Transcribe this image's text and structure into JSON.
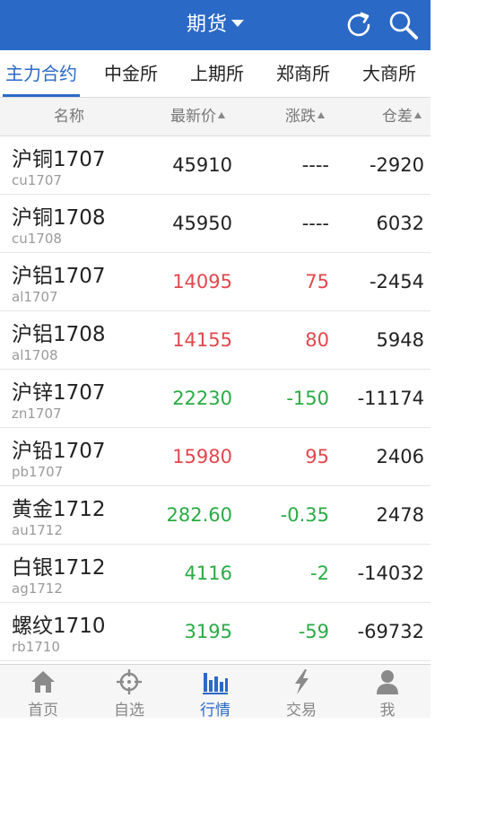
{
  "header": {
    "title": "期货"
  },
  "tabs": [
    {
      "label": "主力合约",
      "active": true
    },
    {
      "label": "中金所",
      "active": false
    },
    {
      "label": "上期所",
      "active": false
    },
    {
      "label": "郑商所",
      "active": false
    },
    {
      "label": "大商所",
      "active": false
    }
  ],
  "columns": {
    "name": "名称",
    "price": "最新价",
    "change": "涨跌",
    "diff": "仓差"
  },
  "rows": [
    {
      "name": "沪铜1707",
      "code": "cu1707",
      "price": "45910",
      "change": "----",
      "diff": "-2920",
      "trend": "flat"
    },
    {
      "name": "沪铜1708",
      "code": "cu1708",
      "price": "45950",
      "change": "----",
      "diff": "6032",
      "trend": "flat"
    },
    {
      "name": "沪铝1707",
      "code": "al1707",
      "price": "14095",
      "change": "75",
      "diff": "-2454",
      "trend": "up"
    },
    {
      "name": "沪铝1708",
      "code": "al1708",
      "price": "14155",
      "change": "80",
      "diff": "5948",
      "trend": "up"
    },
    {
      "name": "沪锌1707",
      "code": "zn1707",
      "price": "22230",
      "change": "-150",
      "diff": "-11174",
      "trend": "down"
    },
    {
      "name": "沪铅1707",
      "code": "pb1707",
      "price": "15980",
      "change": "95",
      "diff": "2406",
      "trend": "up"
    },
    {
      "name": "黄金1712",
      "code": "au1712",
      "price": "282.60",
      "change": "-0.35",
      "diff": "2478",
      "trend": "down"
    },
    {
      "name": "白银1712",
      "code": "ag1712",
      "price": "4116",
      "change": "-2",
      "diff": "-14032",
      "trend": "down"
    },
    {
      "name": "螺纹1710",
      "code": "rb1710",
      "price": "3195",
      "change": "-59",
      "diff": "-69732",
      "trend": "down"
    }
  ],
  "nav": [
    {
      "label": "首页",
      "icon": "home-icon",
      "active": false
    },
    {
      "label": "自选",
      "icon": "crosshair-icon",
      "active": false
    },
    {
      "label": "行情",
      "icon": "bar-chart-icon",
      "active": true
    },
    {
      "label": "交易",
      "icon": "lightning-icon",
      "active": false
    },
    {
      "label": "我",
      "icon": "user-icon",
      "active": false
    }
  ],
  "colors": {
    "brand": "#2b69c6",
    "up": "#e2474d",
    "down": "#2aab44",
    "flat": "#222222"
  }
}
